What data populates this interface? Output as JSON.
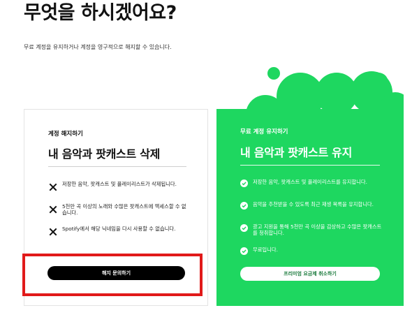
{
  "page": {
    "title": "무엇을 하시겠어요?",
    "subtitle": "무료 계정을 유지하거나 계정을 영구적으로 해지할 수 있습니다."
  },
  "delete_card": {
    "kicker": "계정 해지하기",
    "headline": "내 음악과 팟캐스트 삭제",
    "items": [
      {
        "icon": "x-icon",
        "text": "저장한 음악, 팟캐스트 및 플레이리스트가 삭제됩니다."
      },
      {
        "icon": "x-icon",
        "text": "5천만 곡 이상의 노래와 수많은 팟캐스트에 액세스할 수 없습니다."
      },
      {
        "icon": "x-icon",
        "text": "Spotify에서 해당 닉네임을 다시 사용할 수 없습니다."
      }
    ],
    "button_label": "해지 문의하기"
  },
  "keep_card": {
    "kicker": "무료 계정 유지하기",
    "headline": "내 음악과 팟캐스트 유지",
    "items": [
      {
        "icon": "check-circle-icon",
        "text": "저장한 음악, 팟캐스트 및 플레이리스트를 유지합니다."
      },
      {
        "icon": "check-circle-icon",
        "text": "음악을 추천받을 수 있도록 최근 재생 목록을 유지합니다."
      },
      {
        "icon": "check-circle-icon",
        "text": "광고 지원을 통해 5천만 곡 이상을 감상하고 수많은 팟캐스트를 청취합니다."
      },
      {
        "icon": "check-circle-icon",
        "text": "무료입니다."
      }
    ],
    "button_label": "프리미엄 요금제 취소하기"
  },
  "colors": {
    "spotify_green": "#1ed760",
    "highlight_red": "#e11a1a",
    "button_black": "#000000"
  }
}
